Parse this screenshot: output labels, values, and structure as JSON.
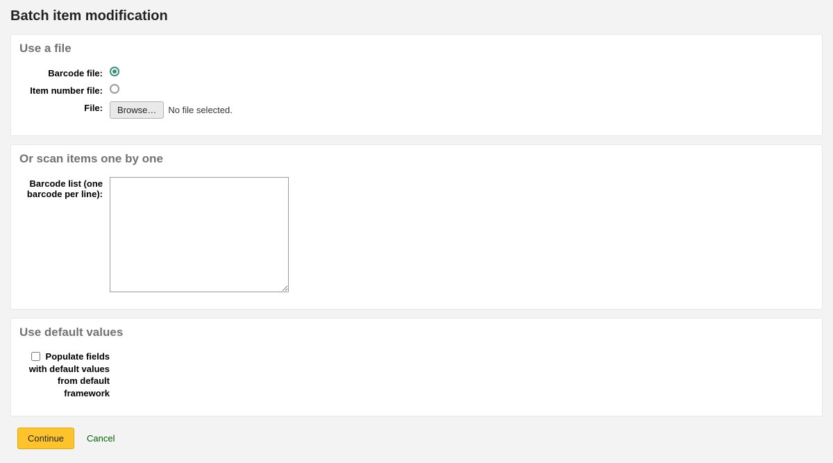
{
  "page": {
    "title": "Batch item modification"
  },
  "file_section": {
    "heading": "Use a file",
    "barcode_file_label": "Barcode file:",
    "itemnumber_file_label": "Item number file:",
    "file_label": "File:",
    "browse_button": "Browse…",
    "no_file_text": "No file selected."
  },
  "scan_section": {
    "heading": "Or scan items one by one",
    "barcode_list_label": "Barcode list (one barcode per line):"
  },
  "defaults_section": {
    "heading": "Use default values",
    "populate_label": "Populate fields with default values from default framework"
  },
  "actions": {
    "continue": "Continue",
    "cancel": "Cancel"
  }
}
